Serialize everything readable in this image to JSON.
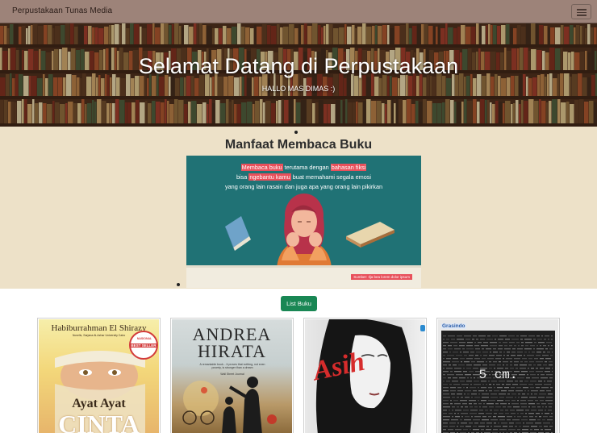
{
  "navbar": {
    "brand": "Perpustakaan Tunas Media"
  },
  "hero": {
    "title": "Selamat Datang di Perpustakaan",
    "greeting": "HALLO MAS DIMAS :)"
  },
  "benefit": {
    "title": "Manfaat Membaca Buku",
    "poster": {
      "w1": "Membaca buku",
      "w2": " terutama dengan ",
      "w3": "bahasan fiksi",
      "w4": "bisa ",
      "w5": "ngebantu kamu",
      "w6": " buat memahami segala emosi",
      "w7": "yang orang lain rasain dan juga apa yang orang lain pikirkan",
      "credit": "Sumber: Ilja bea lorem dolor ipsum"
    }
  },
  "list_button": {
    "label": "List Buku"
  },
  "books": [
    {
      "author": "Habiburrahman El Shirazy",
      "subtitle": "Novelis, Sarjana Al-Azhar University Cairo",
      "badge": "BEST SELLER",
      "badge_top": "NASIONAL",
      "title_a": "Ayat Ayat",
      "title_b": "CINTA"
    },
    {
      "author": "ANDREA",
      "author2": "HIRATA",
      "blurb": "A remarkable book... it proves that nothing, not even poverty, is stronger than a dream",
      "blurb_src": "Wall Street Journal"
    },
    {
      "title": "Asih"
    },
    {
      "publisher": "Grasindo",
      "title": "5 cm."
    }
  ],
  "colors": {
    "navbar": "#9d8379",
    "section": "#ede1c8",
    "poster": "#207275",
    "accent": "#e8505b",
    "button": "#198754"
  }
}
